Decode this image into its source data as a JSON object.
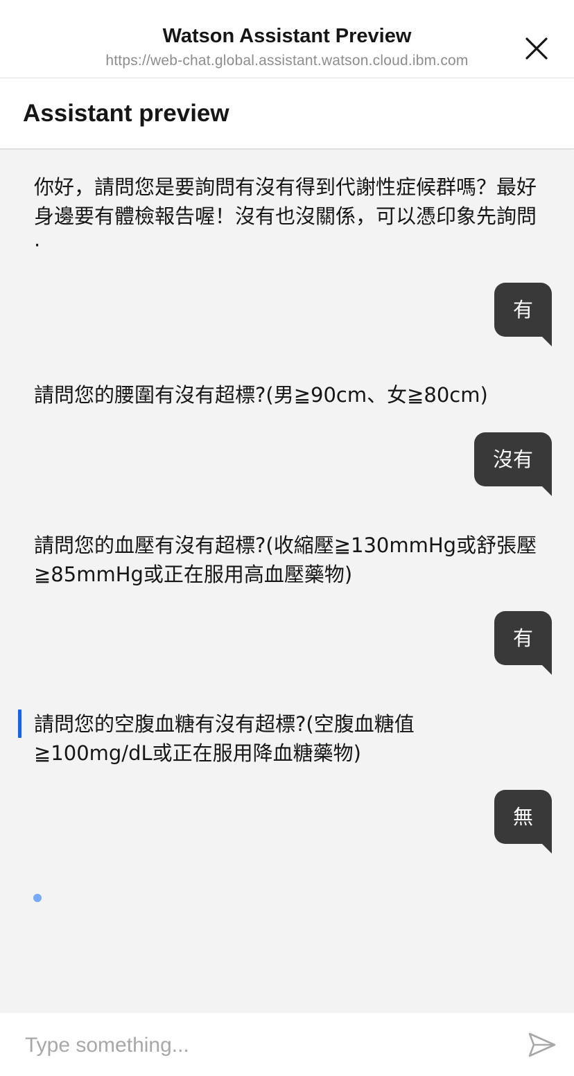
{
  "window": {
    "title": "Watson Assistant Preview",
    "url": "https://web-chat.global.assistant.watson.cloud.ibm.com"
  },
  "panel": {
    "title": "Assistant preview"
  },
  "messages": [
    {
      "role": "bot",
      "text": "你好，請問您是要詢問有沒有得到代謝性症候群嗎？最好身邊要有體檢報告喔！沒有也沒關係，可以憑印象先詢問·"
    },
    {
      "role": "user",
      "text": "有"
    },
    {
      "role": "bot",
      "text": "請問您的腰圍有沒有超標?(男≧90cm、女≧80cm)"
    },
    {
      "role": "user",
      "text": "沒有"
    },
    {
      "role": "bot",
      "text": "請問您的血壓有沒有超標?(收縮壓≧130mmHg或舒張壓≧85mmHg或正在服用高血壓藥物)"
    },
    {
      "role": "user",
      "text": "有"
    },
    {
      "role": "bot",
      "text": "請問您的空腹血糖有沒有超標?(空腹血糖值≧100mg/dL或正在服用降血糖藥物)"
    },
    {
      "role": "user",
      "text": "無"
    }
  ],
  "input": {
    "placeholder": "Type something...",
    "value": ""
  },
  "icons": {
    "close": "close-icon",
    "send": "send-icon"
  },
  "colors": {
    "accent": "#0f62fe",
    "user_bubble": "#393939",
    "chat_background": "#f3f3f3",
    "typing_dot": "#78a9ff"
  }
}
